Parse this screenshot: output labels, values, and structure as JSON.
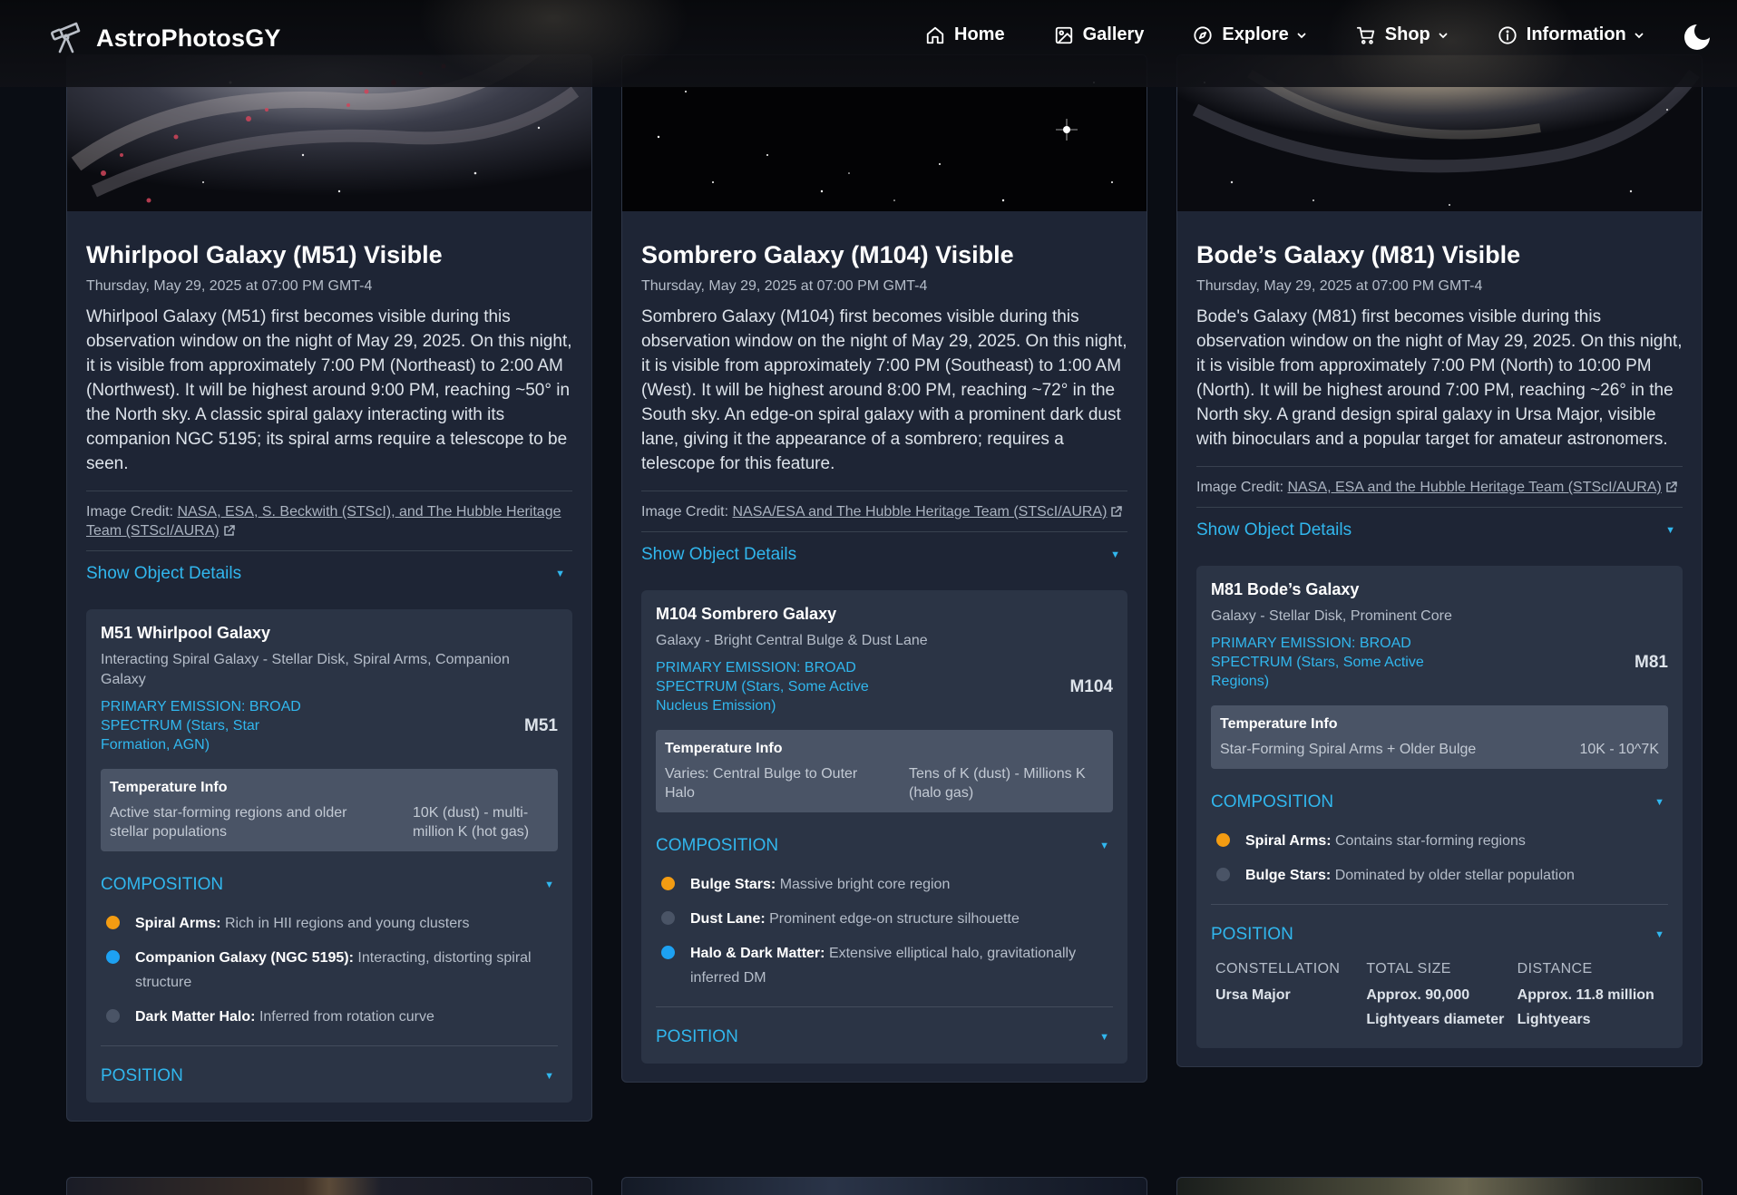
{
  "header": {
    "brand": "AstroPhotosGY",
    "nav": [
      {
        "label": "Home",
        "icon": "home-icon"
      },
      {
        "label": "Gallery",
        "icon": "image-icon"
      },
      {
        "label": "Explore",
        "icon": "compass-icon",
        "dropdown": true
      },
      {
        "label": "Shop",
        "icon": "cart-icon",
        "dropdown": true
      },
      {
        "label": "Information",
        "icon": "info-icon",
        "dropdown": true
      }
    ],
    "theme_icon": "moon-icon"
  },
  "cards": [
    {
      "title": "Whirlpool Galaxy (M51) Visible",
      "date": "Thursday, May 29, 2025 at 07:00 PM GMT-4",
      "description": "Whirlpool Galaxy (M51) first becomes visible during this observation window on the night of May 29, 2025. On this night, it is visible from approximately 7:00 PM (Northeast) to 2:00 AM (Northwest). It will be highest around 9:00 PM, reaching ~50° in the North sky. A classic spiral galaxy interacting with its companion NGC 5195; its spiral arms require a telescope to be seen.",
      "credit_label": "Image Credit:",
      "credit_link": "NASA, ESA, S. Beckwith (STScI), and The Hubble Heritage Team (STScI/AURA)",
      "toggle_label": "Show Object Details",
      "object_name": "M51 Whirlpool Galaxy",
      "object_type": "Interacting Spiral Galaxy - Stellar Disk, Spiral Arms, Companion Galaxy",
      "emission": "PRIMARY EMISSION: BROAD SPECTRUM (Stars, Star Formation, AGN)",
      "code": "M51",
      "temp_title": "Temperature Info",
      "temp_left": "Active star-forming regions and older stellar populations",
      "temp_right": "10K (dust) - multi-million K (hot gas)",
      "composition_label": "COMPOSITION",
      "composition": [
        {
          "name": "Spiral Arms:",
          "text": "Rich in HII regions and young clusters",
          "color": "#f39c12"
        },
        {
          "name": "Companion Galaxy (NGC 5195):",
          "text": "Interacting, distorting spiral structure",
          "color": "#1da1f2"
        },
        {
          "name": "Dark Matter Halo:",
          "text": "Inferred from rotation curve",
          "color": "#4a5466"
        }
      ],
      "position_label": "POSITION"
    },
    {
      "title": "Sombrero Galaxy (M104) Visible",
      "date": "Thursday, May 29, 2025 at 07:00 PM GMT-4",
      "description": "Sombrero Galaxy (M104) first becomes visible during this observation window on the night of May 29, 2025. On this night, it is visible from approximately 7:00 PM (Southeast) to 1:00 AM (West). It will be highest around 8:00 PM, reaching ~72° in the South sky. An edge-on spiral galaxy with a prominent dark dust lane, giving it the appearance of a sombrero; requires a telescope for this feature.",
      "credit_label": "Image Credit:",
      "credit_link": "NASA/ESA and The Hubble Heritage Team (STScI/AURA)",
      "toggle_label": "Show Object Details",
      "object_name": "M104 Sombrero Galaxy",
      "object_type": "Galaxy - Bright Central Bulge & Dust Lane",
      "emission": "PRIMARY EMISSION: BROAD SPECTRUM (Stars, Some Active Nucleus Emission)",
      "code": "M104",
      "temp_title": "Temperature Info",
      "temp_left": "Varies: Central Bulge to Outer Halo",
      "temp_right": "Tens of K (dust) - Millions K (halo gas)",
      "composition_label": "COMPOSITION",
      "composition": [
        {
          "name": "Bulge Stars:",
          "text": "Massive bright core region",
          "color": "#f39c12"
        },
        {
          "name": "Dust Lane:",
          "text": "Prominent edge-on structure silhouette",
          "color": "#4a5466"
        },
        {
          "name": "Halo & Dark Matter:",
          "text": "Extensive elliptical halo, gravitationally inferred DM",
          "color": "#1da1f2"
        }
      ],
      "position_label": "POSITION"
    },
    {
      "title": "Bode’s Galaxy (M81) Visible",
      "date": "Thursday, May 29, 2025 at 07:00 PM GMT-4",
      "description": "Bode's Galaxy (M81) first becomes visible during this observation window on the night of May 29, 2025. On this night, it is visible from approximately 7:00 PM (North) to 10:00 PM (North). It will be highest around 7:00 PM, reaching ~26° in the North sky. A grand design spiral galaxy in Ursa Major, visible with binoculars and a popular target for amateur astronomers.",
      "credit_label": "Image Credit:",
      "credit_link": "NASA, ESA and the Hubble Heritage Team (STScI/AURA)",
      "toggle_label": "Show Object Details",
      "object_name": "M81 Bode’s Galaxy",
      "object_type": "Galaxy - Stellar Disk, Prominent Core",
      "emission": "PRIMARY EMISSION: BROAD SPECTRUM (Stars, Some Active Regions)",
      "code": "M81",
      "temp_title": "Temperature Info",
      "temp_left": "Star-Forming Spiral Arms + Older Bulge",
      "temp_right": "10K - 10^7K",
      "composition_label": "COMPOSITION",
      "composition": [
        {
          "name": "Spiral Arms:",
          "text": "Contains star-forming regions",
          "color": "#f39c12"
        },
        {
          "name": "Bulge Stars:",
          "text": "Dominated by older stellar population",
          "color": "#4a5466"
        }
      ],
      "position_label": "POSITION",
      "position": [
        {
          "label": "CONSTELLATION",
          "value": "Ursa Major"
        },
        {
          "label": "TOTAL SIZE",
          "value": "Approx. 90,000 Lightyears diameter"
        },
        {
          "label": "DISTANCE",
          "value": "Approx. 11.8 million Lightyears"
        }
      ]
    }
  ]
}
